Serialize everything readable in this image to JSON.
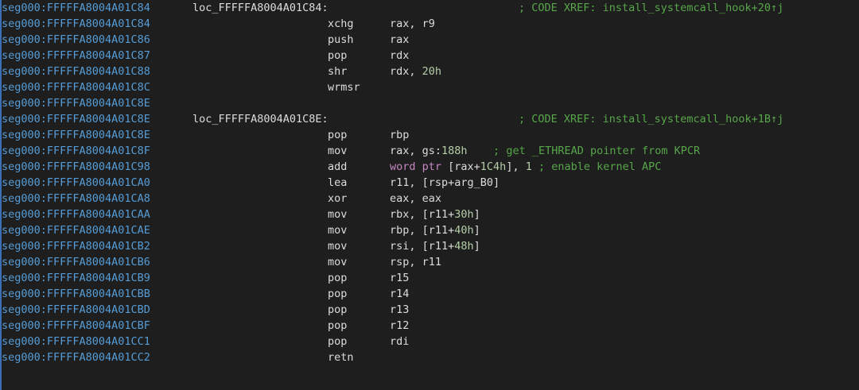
{
  "lines": [
    {
      "addr": "seg000:FFFFFA8004A01C84",
      "label": "loc_FFFFFA8004A01C84:",
      "mnemonic": "",
      "operands": [],
      "comment": "; CODE XREF: install_systemcall_hook+20↑j"
    },
    {
      "addr": "seg000:FFFFFA8004A01C84",
      "label": "",
      "mnemonic": "xchg",
      "operands": [
        {
          "t": "reg",
          "v": "rax, r9"
        }
      ],
      "comment": ""
    },
    {
      "addr": "seg000:FFFFFA8004A01C86",
      "label": "",
      "mnemonic": "push",
      "operands": [
        {
          "t": "reg",
          "v": "rax"
        }
      ],
      "comment": ""
    },
    {
      "addr": "seg000:FFFFFA8004A01C87",
      "label": "",
      "mnemonic": "pop",
      "operands": [
        {
          "t": "reg",
          "v": "rdx"
        }
      ],
      "comment": ""
    },
    {
      "addr": "seg000:FFFFFA8004A01C88",
      "label": "",
      "mnemonic": "shr",
      "operands": [
        {
          "t": "reg",
          "v": "rdx, "
        },
        {
          "t": "num",
          "v": "20h"
        }
      ],
      "comment": ""
    },
    {
      "addr": "seg000:FFFFFA8004A01C8C",
      "label": "",
      "mnemonic": "wrmsr",
      "operands": [],
      "comment": ""
    },
    {
      "addr": "seg000:FFFFFA8004A01C8E",
      "label": "",
      "mnemonic": "",
      "operands": [],
      "comment": ""
    },
    {
      "addr": "seg000:FFFFFA8004A01C8E",
      "label": "loc_FFFFFA8004A01C8E:",
      "mnemonic": "",
      "operands": [],
      "comment": "; CODE XREF: install_systemcall_hook+1B↑j"
    },
    {
      "addr": "seg000:FFFFFA8004A01C8E",
      "label": "",
      "mnemonic": "pop",
      "operands": [
        {
          "t": "reg",
          "v": "rbp"
        }
      ],
      "comment": ""
    },
    {
      "addr": "seg000:FFFFFA8004A01C8F",
      "label": "",
      "mnemonic": "mov",
      "operands": [
        {
          "t": "reg",
          "v": "rax, gs:"
        },
        {
          "t": "num",
          "v": "188h"
        },
        {
          "t": "cmt",
          "v": "    ; get _ETHREAD pointer from KPCR"
        }
      ],
      "comment": ""
    },
    {
      "addr": "seg000:FFFFFA8004A01C98",
      "label": "",
      "mnemonic": "add",
      "operands": [
        {
          "t": "kw",
          "v": "word ptr "
        },
        {
          "t": "reg",
          "v": "[rax+"
        },
        {
          "t": "num",
          "v": "1C4h"
        },
        {
          "t": "reg",
          "v": "], "
        },
        {
          "t": "num",
          "v": "1"
        },
        {
          "t": "cmt",
          "v": " ; enable kernel APC"
        }
      ],
      "comment": ""
    },
    {
      "addr": "seg000:FFFFFA8004A01CA0",
      "label": "",
      "mnemonic": "lea",
      "operands": [
        {
          "t": "reg",
          "v": "r11, [rsp+arg_B0]"
        }
      ],
      "comment": ""
    },
    {
      "addr": "seg000:FFFFFA8004A01CA8",
      "label": "",
      "mnemonic": "xor",
      "operands": [
        {
          "t": "reg",
          "v": "eax, eax"
        }
      ],
      "comment": ""
    },
    {
      "addr": "seg000:FFFFFA8004A01CAA",
      "label": "",
      "mnemonic": "mov",
      "operands": [
        {
          "t": "reg",
          "v": "rbx, [r11+"
        },
        {
          "t": "num",
          "v": "30h"
        },
        {
          "t": "reg",
          "v": "]"
        }
      ],
      "comment": ""
    },
    {
      "addr": "seg000:FFFFFA8004A01CAE",
      "label": "",
      "mnemonic": "mov",
      "operands": [
        {
          "t": "reg",
          "v": "rbp, [r11+"
        },
        {
          "t": "num",
          "v": "40h"
        },
        {
          "t": "reg",
          "v": "]"
        }
      ],
      "comment": ""
    },
    {
      "addr": "seg000:FFFFFA8004A01CB2",
      "label": "",
      "mnemonic": "mov",
      "operands": [
        {
          "t": "reg",
          "v": "rsi, [r11+"
        },
        {
          "t": "num",
          "v": "48h"
        },
        {
          "t": "reg",
          "v": "]"
        }
      ],
      "comment": ""
    },
    {
      "addr": "seg000:FFFFFA8004A01CB6",
      "label": "",
      "mnemonic": "mov",
      "operands": [
        {
          "t": "reg",
          "v": "rsp, r11"
        }
      ],
      "comment": ""
    },
    {
      "addr": "seg000:FFFFFA8004A01CB9",
      "label": "",
      "mnemonic": "pop",
      "operands": [
        {
          "t": "reg",
          "v": "r15"
        }
      ],
      "comment": ""
    },
    {
      "addr": "seg000:FFFFFA8004A01CBB",
      "label": "",
      "mnemonic": "pop",
      "operands": [
        {
          "t": "reg",
          "v": "r14"
        }
      ],
      "comment": ""
    },
    {
      "addr": "seg000:FFFFFA8004A01CBD",
      "label": "",
      "mnemonic": "pop",
      "operands": [
        {
          "t": "reg",
          "v": "r13"
        }
      ],
      "comment": ""
    },
    {
      "addr": "seg000:FFFFFA8004A01CBF",
      "label": "",
      "mnemonic": "pop",
      "operands": [
        {
          "t": "reg",
          "v": "r12"
        }
      ],
      "comment": ""
    },
    {
      "addr": "seg000:FFFFFA8004A01CC1",
      "label": "",
      "mnemonic": "pop",
      "operands": [
        {
          "t": "reg",
          "v": "rdi"
        }
      ],
      "comment": ""
    },
    {
      "addr": "seg000:FFFFFA8004A01CC2",
      "label": "",
      "mnemonic": "retn",
      "operands": [],
      "comment": ""
    }
  ],
  "colors": {
    "background": "#1e1e1e",
    "address": "#569cd6",
    "text": "#dcdcdc",
    "number": "#b5cea8",
    "keyword": "#c586c0",
    "comment": "#57a64a"
  }
}
